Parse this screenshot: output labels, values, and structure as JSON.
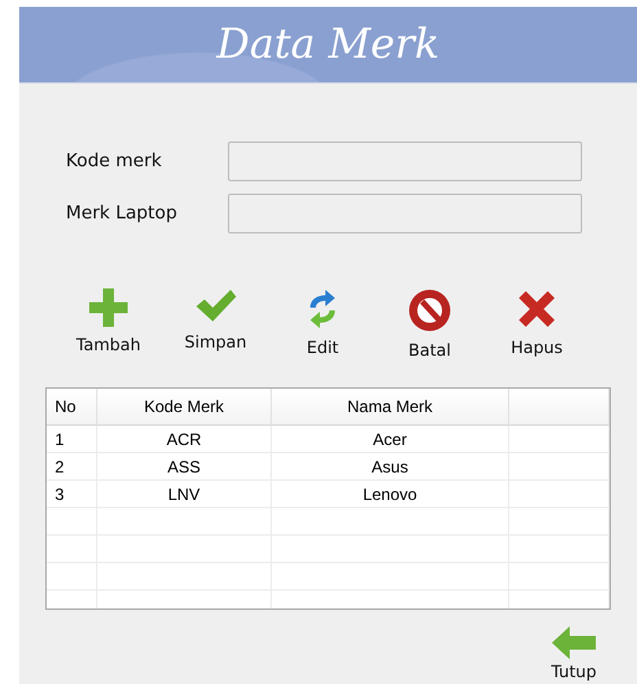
{
  "header": {
    "title": "Data Merk"
  },
  "form": {
    "fields": [
      {
        "label": "Kode merk"
      },
      {
        "label": "Merk Laptop"
      }
    ]
  },
  "toolbar": [
    {
      "kind": "add",
      "label": "Tambah"
    },
    {
      "kind": "save",
      "label": "Simpan"
    },
    {
      "kind": "edit",
      "label": "Edit"
    },
    {
      "kind": "cancel",
      "label": "Batal"
    },
    {
      "kind": "delete",
      "label": "Hapus"
    }
  ],
  "table": {
    "columns": [
      "No",
      "Kode Merk",
      "Nama Merk"
    ],
    "rows": [
      [
        "1",
        "ACR",
        "Acer"
      ],
      [
        "2",
        "ASS",
        "Asus"
      ],
      [
        "3",
        "LNV",
        "Lenovo"
      ]
    ]
  },
  "close_button": {
    "label": "Tutup"
  }
}
